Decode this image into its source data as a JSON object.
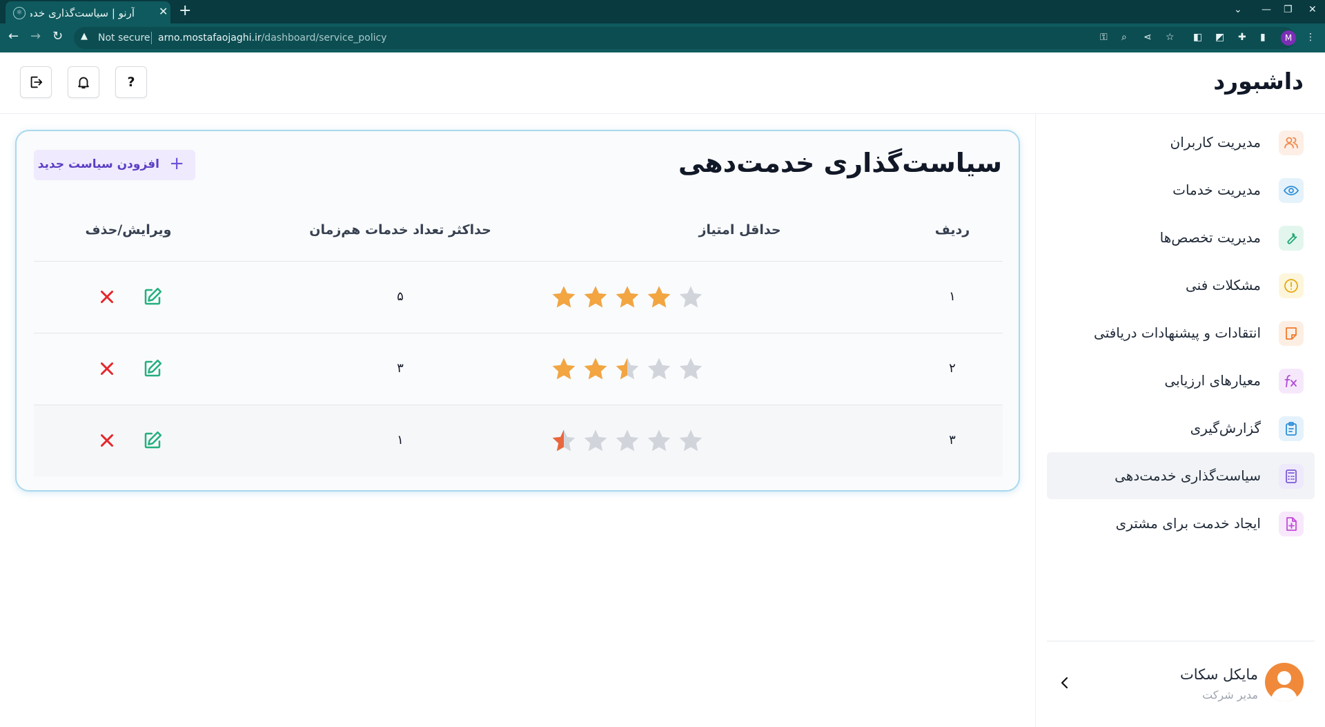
{
  "browser": {
    "tab_title": "آرنو | سیاست‌گذاری خدمت‌دهی",
    "security_label": "Not secure",
    "url_host": "arno.mostafaojaghi.ir",
    "url_path": "/dashboard/service_policy",
    "profile_initial": "M"
  },
  "header": {
    "brand": "داشبورد",
    "help_label": "?"
  },
  "sidebar": {
    "items": [
      {
        "label": "مدیریت کاربران",
        "icon": "users-icon",
        "color": "#f08a4b",
        "bg": "#fdefe6"
      },
      {
        "label": "مدیریت خدمات",
        "icon": "eye-icon",
        "color": "#2f8fd8",
        "bg": "#e5f2fb"
      },
      {
        "label": "مدیریت تخصص‌ها",
        "icon": "wrench-icon",
        "color": "#1ea672",
        "bg": "#e3f6ee"
      },
      {
        "label": "مشکلات فنی",
        "icon": "alert-circle-icon",
        "color": "#e4a911",
        "bg": "#fdf6dc"
      },
      {
        "label": "انتقادات و پیشنهادات دریافتی",
        "icon": "note-icon",
        "color": "#f07a2b",
        "bg": "#fdeee3"
      },
      {
        "label": "معیارهای ارزیابی",
        "icon": "function-icon",
        "color": "#b04ad8",
        "bg": "#f6e8fb"
      },
      {
        "label": "گزارش‌گیری",
        "icon": "clipboard-icon",
        "color": "#2f8fd8",
        "bg": "#e5f2fb"
      },
      {
        "label": "سیاست‌گذاری خدمت‌دهی",
        "icon": "calculator-icon",
        "color": "#7c5ad8",
        "bg": "#eee9fb",
        "active": true
      },
      {
        "label": "ایجاد خدمت برای مشتری",
        "icon": "file-plus-icon",
        "color": "#c24ad8",
        "bg": "#f8e8fb"
      }
    ],
    "profile": {
      "name": "مایکل سکات",
      "role": "مدیر شرکت"
    }
  },
  "main": {
    "title": "سیاست‌گذاری خدمت‌دهی",
    "add_button": "افزودن سیاست جدید",
    "columns": {
      "row": "ردیف",
      "min_score": "حداقل امتیاز",
      "max_services": "حداکثر تعداد خدمات هم‌زمان",
      "actions": "ویرایش/حذف"
    },
    "rows": [
      {
        "index": "۱",
        "rating": 4,
        "max": "۵"
      },
      {
        "index": "۲",
        "rating": 2.5,
        "max": "۳"
      },
      {
        "index": "۳",
        "rating": 0.5,
        "max": "۱"
      }
    ],
    "colors": {
      "star_full": "#f2a541",
      "star_empty": "#d1d5db",
      "star_half_low": "#e8673c",
      "edit": "#22b07d",
      "delete": "#e5262b"
    }
  }
}
